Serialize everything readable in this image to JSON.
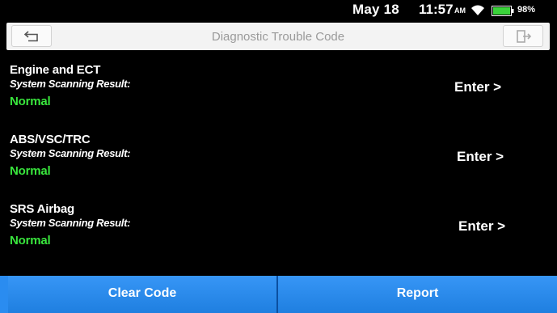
{
  "status_bar": {
    "date": "May 18",
    "time": "11:57",
    "ampm": "AM",
    "battery": "98%"
  },
  "header": {
    "title": "Diagnostic Trouble Code"
  },
  "systems": [
    {
      "name": "Engine and ECT",
      "label": "System Scanning Result:",
      "status": "Normal",
      "action": "Enter >"
    },
    {
      "name": "ABS/VSC/TRC",
      "label": "System Scanning Result:",
      "status": "Normal",
      "action": "Enter >"
    },
    {
      "name": "SRS Airbag",
      "label": "System Scanning Result:",
      "status": "Normal",
      "action": "Enter >"
    }
  ],
  "footer": {
    "clear_label": "Clear Code",
    "report_label": "Report"
  },
  "colors": {
    "status_normal": "#39e63d",
    "footer_button": "#2a8cf0",
    "background": "#000000"
  },
  "icons": {
    "back": "back-arrow-icon",
    "exit": "exit-icon",
    "wifi": "wifi-icon",
    "battery": "battery-icon"
  }
}
